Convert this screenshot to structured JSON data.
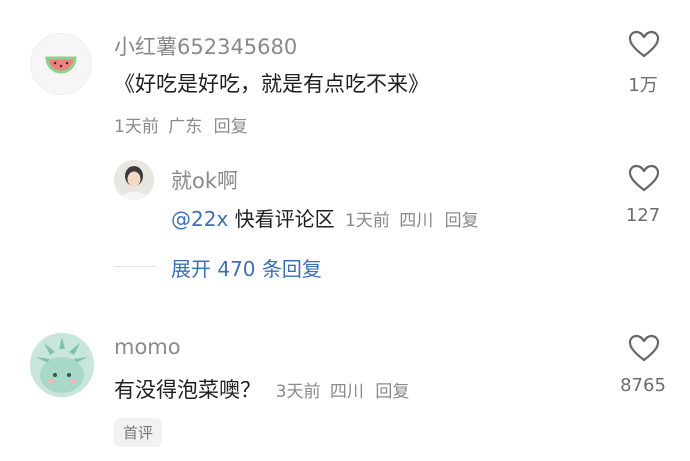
{
  "comments": [
    {
      "user": "小红薯652345680",
      "text": "《好吃是好吃，就是有点吃不来》",
      "time": "1天前",
      "location": "广东",
      "reply_label": "回复",
      "like_count": "1万",
      "avatar_icon": "watermelon-icon"
    },
    {
      "user": "momo",
      "text": "有没得泡菜噢？",
      "time": "3天前",
      "location": "四川",
      "reply_label": "回复",
      "like_count": "8765",
      "tag": "首评",
      "avatar_icon": "statue-of-liberty-icon"
    }
  ],
  "reply": {
    "user": "就ok啊",
    "mention": "@22x",
    "text": " 快看评论区",
    "time": "1天前",
    "location": "四川",
    "reply_label": "回复",
    "like_count": "127"
  },
  "expand": {
    "label": "展开 470 条回复"
  },
  "colors": {
    "link": "#3d6fb6",
    "muted": "#8a8a8a",
    "text": "#1f1f1f"
  }
}
